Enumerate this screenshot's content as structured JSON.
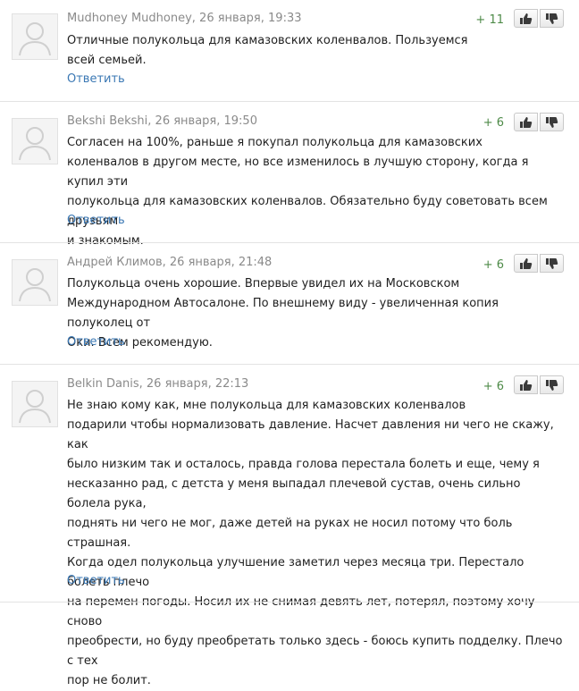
{
  "reply_label": "Ответить",
  "colors": {
    "link": "#3b78b4",
    "score": "#4d8a47",
    "meta": "#8a8a8a"
  },
  "comments": [
    {
      "author": "Mudhoney Mudhoney",
      "date": ", 26 января, 19:33",
      "score": "+ 11",
      "text": "Отличные полукольца для камазовских коленвалов. Пользуемся\nвсей семьей."
    },
    {
      "author": "Bekshi Bekshi",
      "date": ", 26 января, 19:50",
      "score": "+ 6",
      "text": "Согласен на 100%, раньше я покупал полукольца для камазовских\nколенвалов в другом месте, но все изменилось в лучшую сторону, когда я купил эти\nполукольца для камазовских коленвалов. Обязательно буду советовать всем друзьям\nи знакомым."
    },
    {
      "author": "Андрей Климов",
      "date": ", 26 января, 21:48",
      "score": "+ 6",
      "text": "Полукольца очень хорошие. Впервые увидел их на Московском\nМеждународном Автосалоне. По внешнему виду - увеличенная копия полуколец от\nОки. Всем рекомендую."
    },
    {
      "author": "Belkin Danis",
      "date": ", 26 января, 22:13",
      "score": "+ 6",
      "text": "Не знаю кому как, мне полукольца для камазовских коленвалов\nподарили чтобы нормализовать давление. Насчет давления ни чего не скажу, как\nбыло низким так и осталось, правда голова перестала болеть и еще, чему я\nнесказанно рад, с детста у меня выпадал плечевой сустав, очень сильно болела рука,\nподнять ни чего не мог, даже детей на руках не носил потому что боль страшная.\nКогда одел полукольца улучшение заметил через месяца три. Перестало болеть плечо\nна перемен погоды. Носил их не снимая девять лет, потерял, поэтому хочу сново\nпреобрести, но буду преобретать только здесь - боюсь купить подделку. Плечо с тех\nпор не болит."
    }
  ]
}
